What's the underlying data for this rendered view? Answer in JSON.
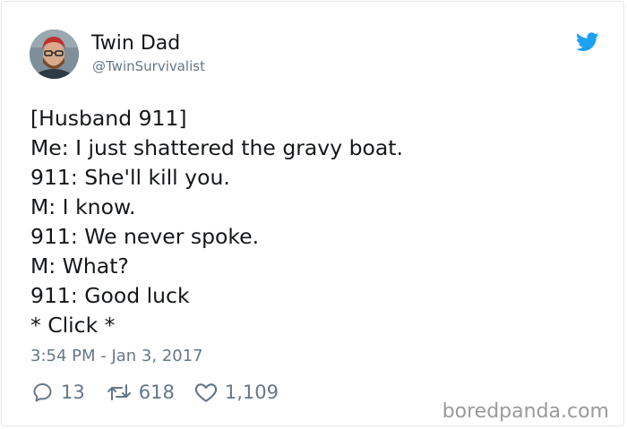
{
  "header": {
    "display_name": "Twin Dad",
    "handle": "@TwinSurvivalist",
    "logo_icon": "twitter-bird-icon",
    "brand_color": "#1da1f2"
  },
  "tweet": {
    "lines": [
      "[Husband 911]",
      "Me: I just shattered the gravy boat.",
      "911: She'll kill you.",
      "M: I know.",
      "911: We never spoke.",
      "M: What?",
      "911: Good luck",
      "* Click *"
    ],
    "timestamp": "3:54 PM - Jan 3, 2017"
  },
  "actions": {
    "reply_count": "13",
    "retweet_count": "618",
    "like_count": "1,109",
    "icon_color": "#657786"
  },
  "watermark": "boredpanda.com"
}
